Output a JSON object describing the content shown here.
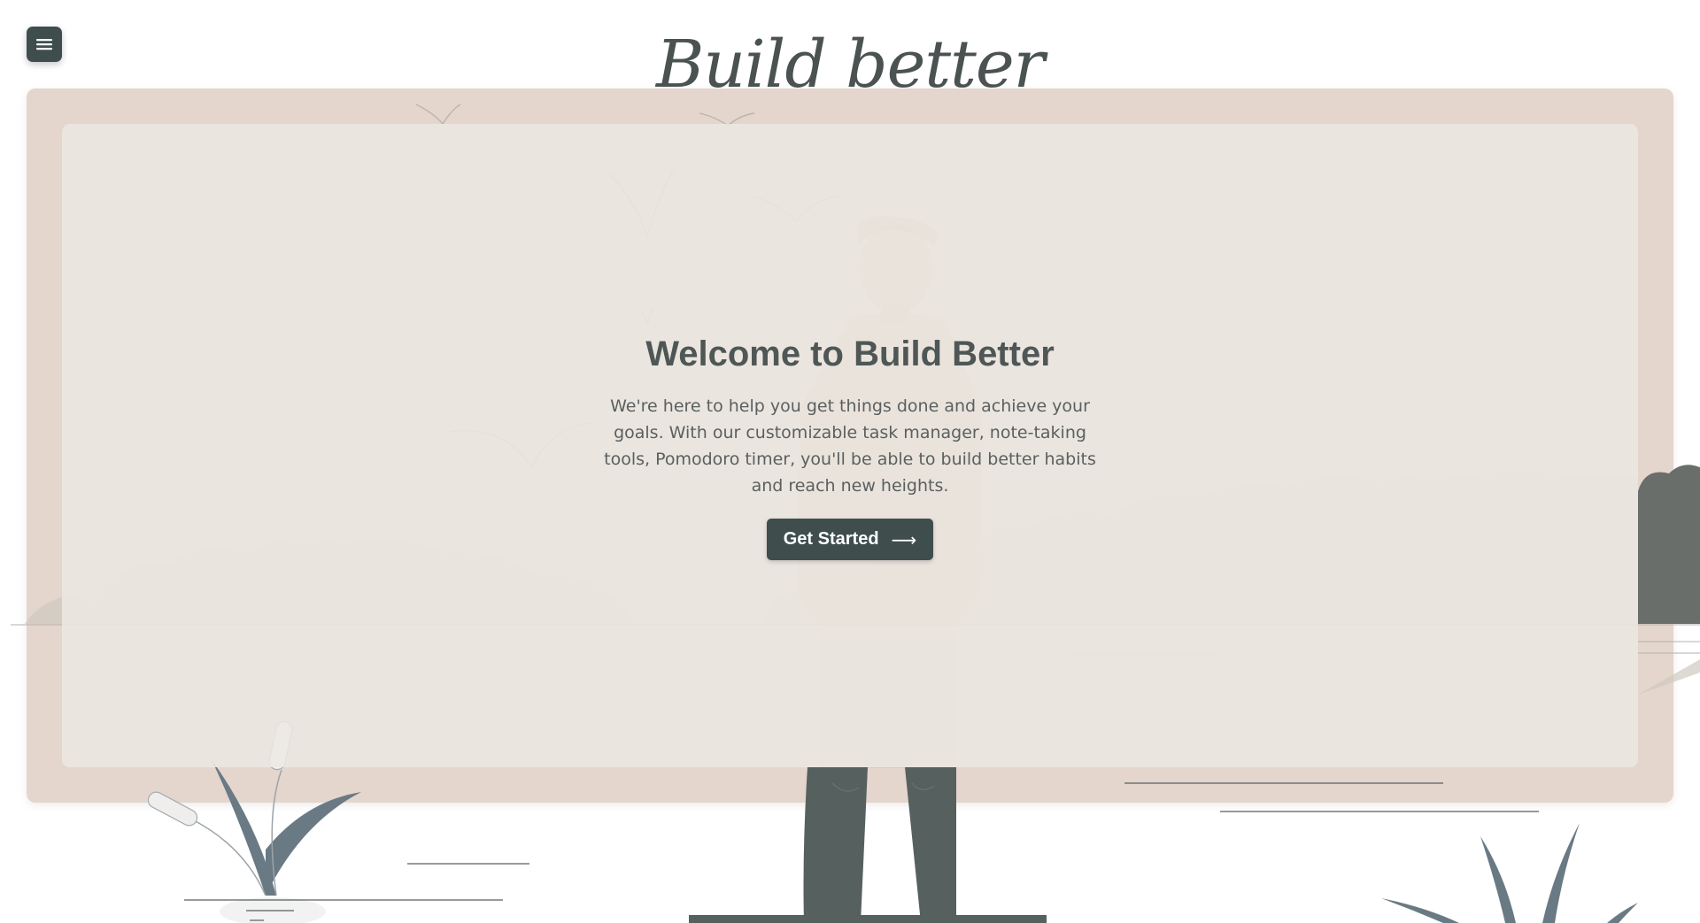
{
  "brand": {
    "logo_text": "Build better"
  },
  "hero": {
    "title": "Welcome to Build Better",
    "description": "We're here to help you get things done and achieve your goals. With our customizable task manager, note-taking tools, Pomodoro timer, you'll be able to build better habits and reach new heights.",
    "cta_label": "Get Started",
    "cta_arrow": "⟶"
  },
  "icons": {
    "menu": "hamburger-menu-icon",
    "cta_arrow": "arrow-right-icon"
  },
  "colors": {
    "page_background": "#ffffff",
    "frame_background": "#e4d6cd",
    "panel_background": "#ece8e2",
    "accent_dark": "#3f4d4d",
    "heading_text": "#4e5756",
    "body_text": "#5a605f",
    "illustration_slate": "#56605f",
    "illustration_blue_gray": "#6a7a84"
  }
}
